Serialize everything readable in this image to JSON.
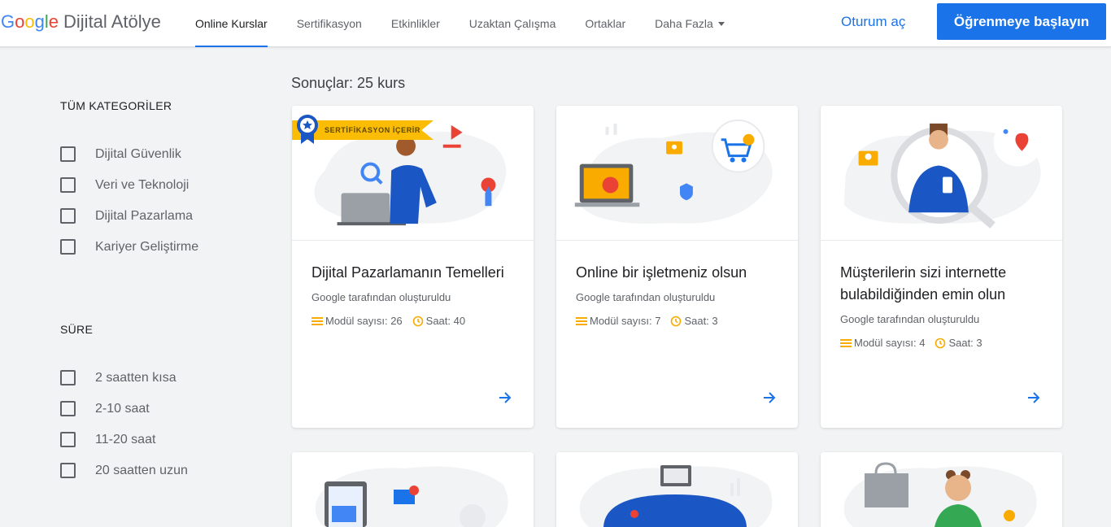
{
  "brand": {
    "google": [
      "G",
      "o",
      "o",
      "g",
      "l",
      "e"
    ],
    "product": "Dijital Atölye"
  },
  "nav": {
    "items": [
      "Online Kurslar",
      "Sertifikasyon",
      "Etkinlikler",
      "Uzaktan Çalışma",
      "Ortaklar",
      "Daha Fazla"
    ],
    "active": "Online Kurslar"
  },
  "header": {
    "signin": "Oturum aç",
    "start": "Öğrenmeye başlayın"
  },
  "sidebar": {
    "categories_heading": "TÜM KATEGORİLER",
    "categories": [
      "Dijital Güvenlik",
      "Veri ve Teknoloji",
      "Dijital Pazarlama",
      "Kariyer Geliştirme"
    ],
    "duration_heading": "SÜRE",
    "durations": [
      "2 saatten kısa",
      "2-10 saat",
      "11-20 saat",
      "20 saatten uzun"
    ]
  },
  "results": {
    "label": "Sonuçlar: 25 kurs"
  },
  "cards": [
    {
      "title": "Dijital Pazarlamanın Temelleri",
      "by": "Google tarafından oluşturuldu",
      "modules": "Modül sayısı: 26",
      "hours": "Saat: 40",
      "badge": "SERTİFİKASYON İÇERİR"
    },
    {
      "title": "Online bir işletmeniz olsun",
      "by": "Google tarafından oluşturuldu",
      "modules": "Modül sayısı: 7",
      "hours": "Saat: 3"
    },
    {
      "title": "Müşterilerin sizi internette bulabildiğinden emin olun",
      "by": "Google tarafından oluşturuldu",
      "modules": "Modül sayısı: 4",
      "hours": "Saat: 3"
    }
  ],
  "colors": {
    "accent": "#1a73e8",
    "badge": "#fbbc05",
    "icon_yellow": "#f9ab00"
  }
}
